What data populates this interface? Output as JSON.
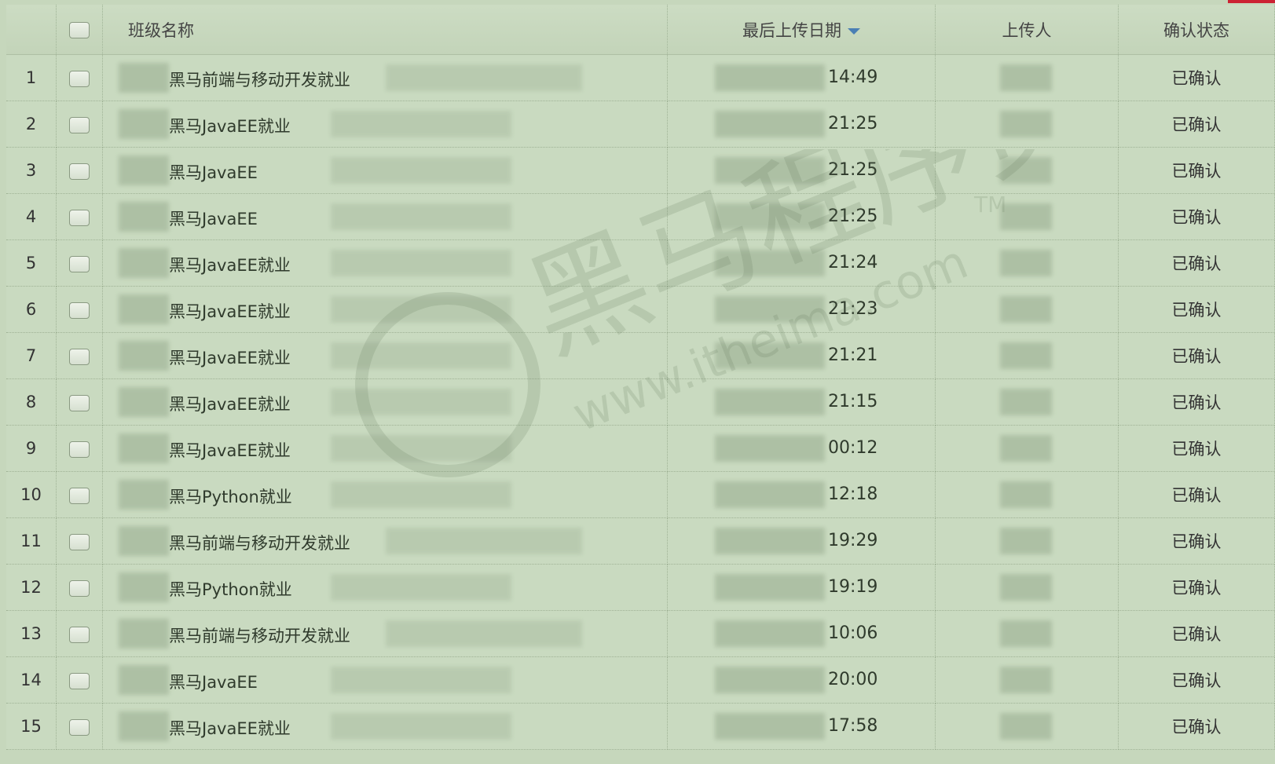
{
  "table": {
    "columns": {
      "class_name": "班级名称",
      "last_upload_date": "最后上传日期",
      "uploader": "上传人",
      "confirm_status": "确认状态"
    },
    "rows": [
      {
        "num": "1",
        "class_name": "黑马前端与移动开发就业",
        "time": "14:49",
        "status": "已确认"
      },
      {
        "num": "2",
        "class_name": "黑马JavaEE就业",
        "time": "21:25",
        "status": "已确认"
      },
      {
        "num": "3",
        "class_name": "黑马JavaEE",
        "time": "21:25",
        "status": "已确认"
      },
      {
        "num": "4",
        "class_name": "黑马JavaEE",
        "time": "21:25",
        "status": "已确认"
      },
      {
        "num": "5",
        "class_name": "黑马JavaEE就业",
        "time": "21:24",
        "status": "已确认"
      },
      {
        "num": "6",
        "class_name": "黑马JavaEE就业",
        "time": "21:23",
        "status": "已确认"
      },
      {
        "num": "7",
        "class_name": "黑马JavaEE就业",
        "time": "21:21",
        "status": "已确认"
      },
      {
        "num": "8",
        "class_name": "黑马JavaEE就业",
        "time": "21:15",
        "status": "已确认"
      },
      {
        "num": "9",
        "class_name": "黑马JavaEE就业",
        "time": "00:12",
        "status": "已确认"
      },
      {
        "num": "10",
        "class_name": "黑马Python就业",
        "time": "12:18",
        "status": "已确认"
      },
      {
        "num": "11",
        "class_name": "黑马前端与移动开发就业",
        "time": "19:29",
        "status": "已确认"
      },
      {
        "num": "12",
        "class_name": "黑马Python就业",
        "time": "19:19",
        "status": "已确认"
      },
      {
        "num": "13",
        "class_name": "黑马前端与移动开发就业",
        "time": "10:06",
        "status": "已确认"
      },
      {
        "num": "14",
        "class_name": "黑马JavaEE",
        "time": "20:00",
        "status": "已确认"
      },
      {
        "num": "15",
        "class_name": "黑马JavaEE就业",
        "time": "17:58",
        "status": "已确认"
      }
    ]
  },
  "watermark": {
    "text": "黑马程序员",
    "url": "www.itheima.com",
    "tm": "TM"
  },
  "colors": {
    "background": "#c6d7bc",
    "sort_arrow": "#4a7fb4",
    "accent_mark": "#cc2233"
  }
}
